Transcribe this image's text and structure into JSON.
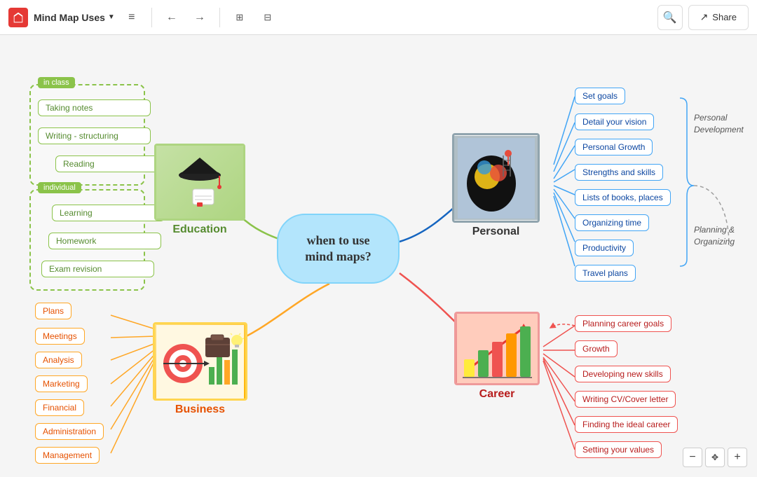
{
  "toolbar": {
    "logo_alt": "Miro logo",
    "title": "Mind Map Uses",
    "undo_label": "Undo",
    "redo_label": "Redo",
    "frame_label": "Frame",
    "present_label": "Present",
    "menu_label": "Menu",
    "search_label": "Search",
    "share_label": "Share"
  },
  "center_node": {
    "text": "when to use\nmind maps?"
  },
  "education": {
    "label": "Education",
    "color": "#8bc34a",
    "in_class_items": [
      "Taking notes",
      "Writing - structuring",
      "Reading"
    ],
    "individual_items": [
      "Learning",
      "Homework",
      "Exam revision"
    ],
    "group1_label": "in class",
    "group2_label": "individual"
  },
  "personal": {
    "label": "Personal",
    "items": [
      "Set goals",
      "Detail your vision",
      "Personal Growth",
      "Strengths and skills",
      "Lists of books, places",
      "Organizing time",
      "Productivity",
      "Travel plans"
    ],
    "sidebar_labels": [
      "Personal\nDevelopment",
      "Planning &\nOrganizing"
    ]
  },
  "business": {
    "label": "Business",
    "color": "#ffa726",
    "items": [
      "Plans",
      "Meetings",
      "Analysis",
      "Marketing",
      "Financial",
      "Administration",
      "Management"
    ]
  },
  "career": {
    "label": "Career",
    "color": "#ef5350",
    "items": [
      "Planning career goals",
      "Growth",
      "Developing new skills",
      "Writing CV/Cover letter",
      "Finding the ideal career",
      "Setting  your values"
    ]
  },
  "zoom": {
    "minus": "−",
    "plus": "+",
    "fit": "⤢"
  }
}
